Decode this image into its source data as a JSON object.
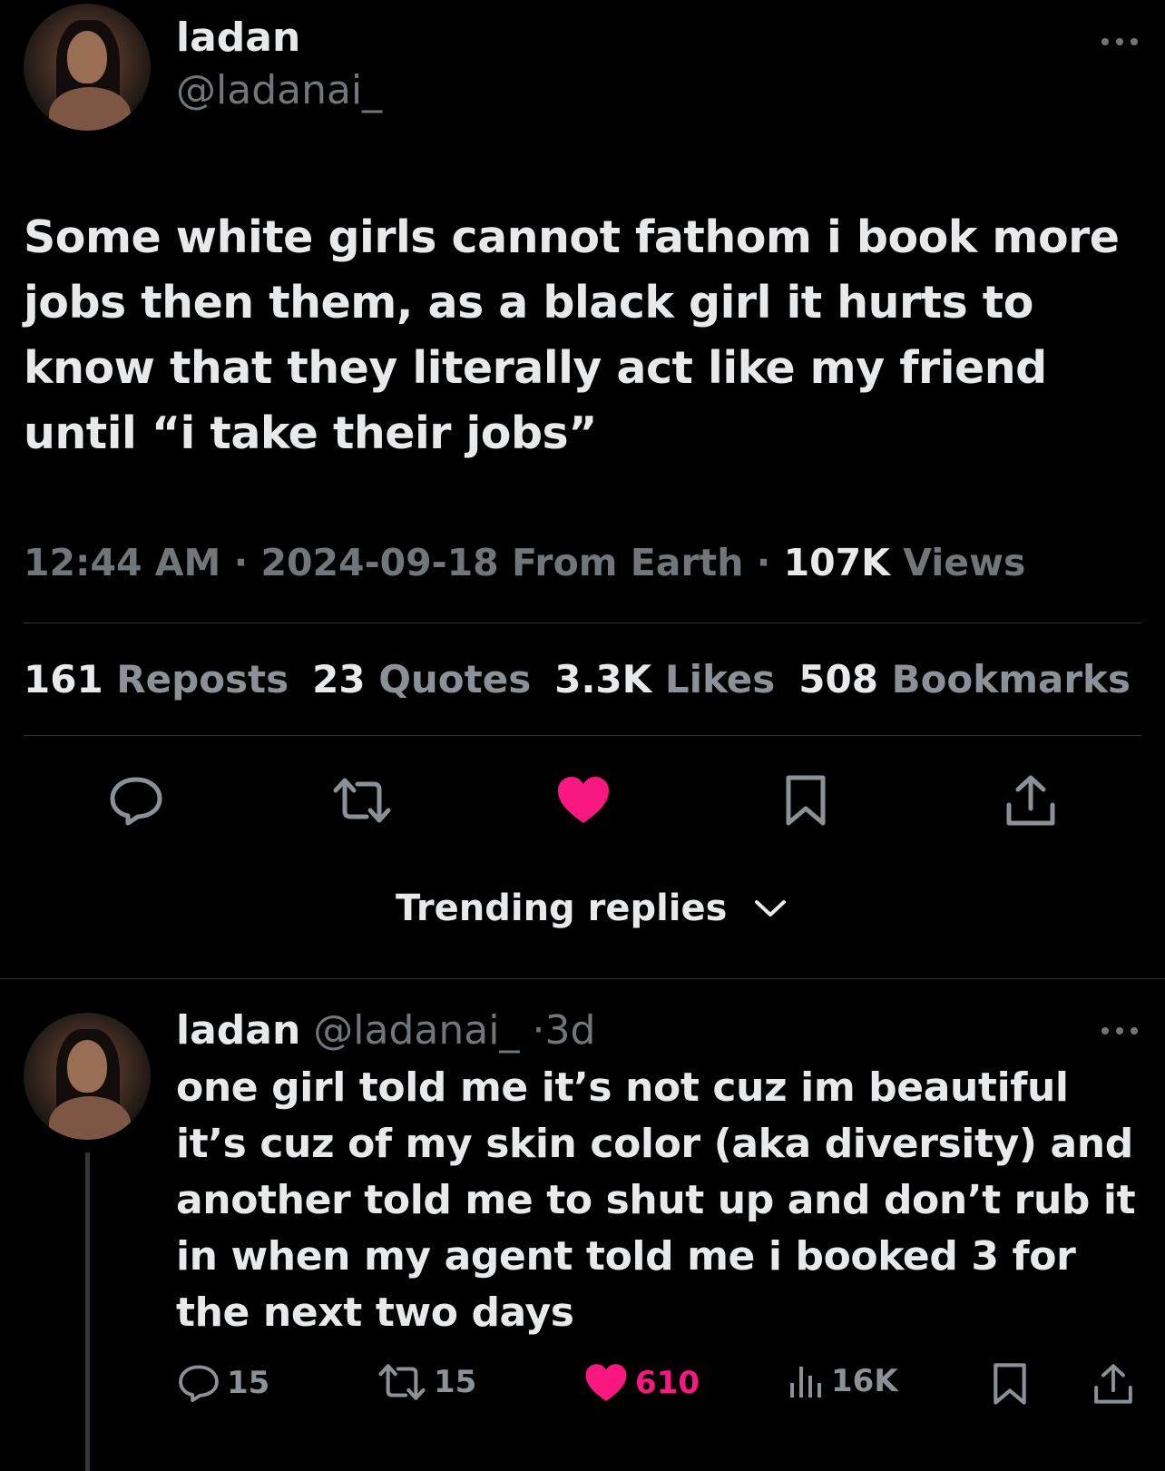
{
  "tweet": {
    "display_name": "ladan",
    "handle": "@ladanai_",
    "text": "Some white girls cannot fathom i book more jobs then them, as a black girl it hurts to know that they literally act like my friend until “i take their jobs”",
    "time": "12:44 AM",
    "date": "2024-09-18",
    "source": "From Earth",
    "views_count": "107K",
    "views_label": "Views",
    "sep": "·"
  },
  "stats": {
    "reposts_count": "161",
    "reposts_label": "Reposts",
    "quotes_count": "23",
    "quotes_label": "Quotes",
    "likes_count": "3.3K",
    "likes_label": "Likes",
    "bookmarks_count": "508",
    "bookmarks_label": "Bookmarks"
  },
  "actions": [
    "reply-icon",
    "repost-icon",
    "like-icon",
    "bookmark-icon",
    "share-icon"
  ],
  "colors": {
    "like_pink": "#f91880",
    "muted": "#71767b",
    "divider": "#2f3336"
  },
  "trending": {
    "label": "Trending replies"
  },
  "reply": {
    "display_name": "ladan",
    "handle": "@ladanai_",
    "sep": "·",
    "age": "3d",
    "text": "one girl told me it’s not cuz im beautiful it’s cuz of my skin color (aka diversity) and another told me to shut up and don’t rub it in when my agent told me i booked 3 for the next two days",
    "replies": "15",
    "reposts": "15",
    "likes": "610",
    "views": "16K"
  }
}
